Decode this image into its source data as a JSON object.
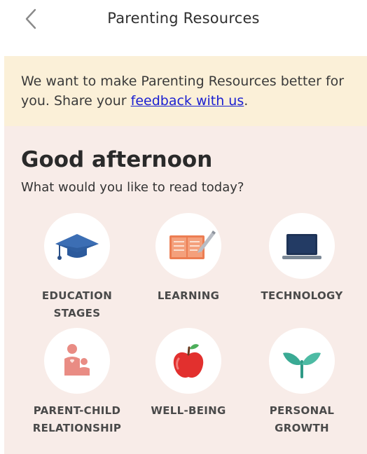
{
  "header": {
    "title": "Parenting Resources",
    "back_icon": "chevron-left-icon"
  },
  "banner": {
    "text_before": "We want to make Parenting Resources better for you. Share your ",
    "link_text": "feedback with us",
    "text_after": "."
  },
  "main": {
    "greeting": "Good afternoon",
    "prompt": "What would you like to read today?",
    "categories": [
      {
        "label": "EDUCATION STAGES",
        "icon": "graduation-cap-icon"
      },
      {
        "label": "LEARNING",
        "icon": "book-icon"
      },
      {
        "label": "TECHNOLOGY",
        "icon": "laptop-icon"
      },
      {
        "label": "PARENT-CHILD RELATIONSHIP",
        "icon": "parent-child-icon"
      },
      {
        "label": "WELL-BEING",
        "icon": "apple-icon"
      },
      {
        "label": "PERSONAL GROWTH",
        "icon": "sprout-icon"
      }
    ]
  },
  "colors": {
    "banner_bg": "#fbf0d8",
    "main_bg": "#f8ece8",
    "link": "#1a1fd1"
  }
}
